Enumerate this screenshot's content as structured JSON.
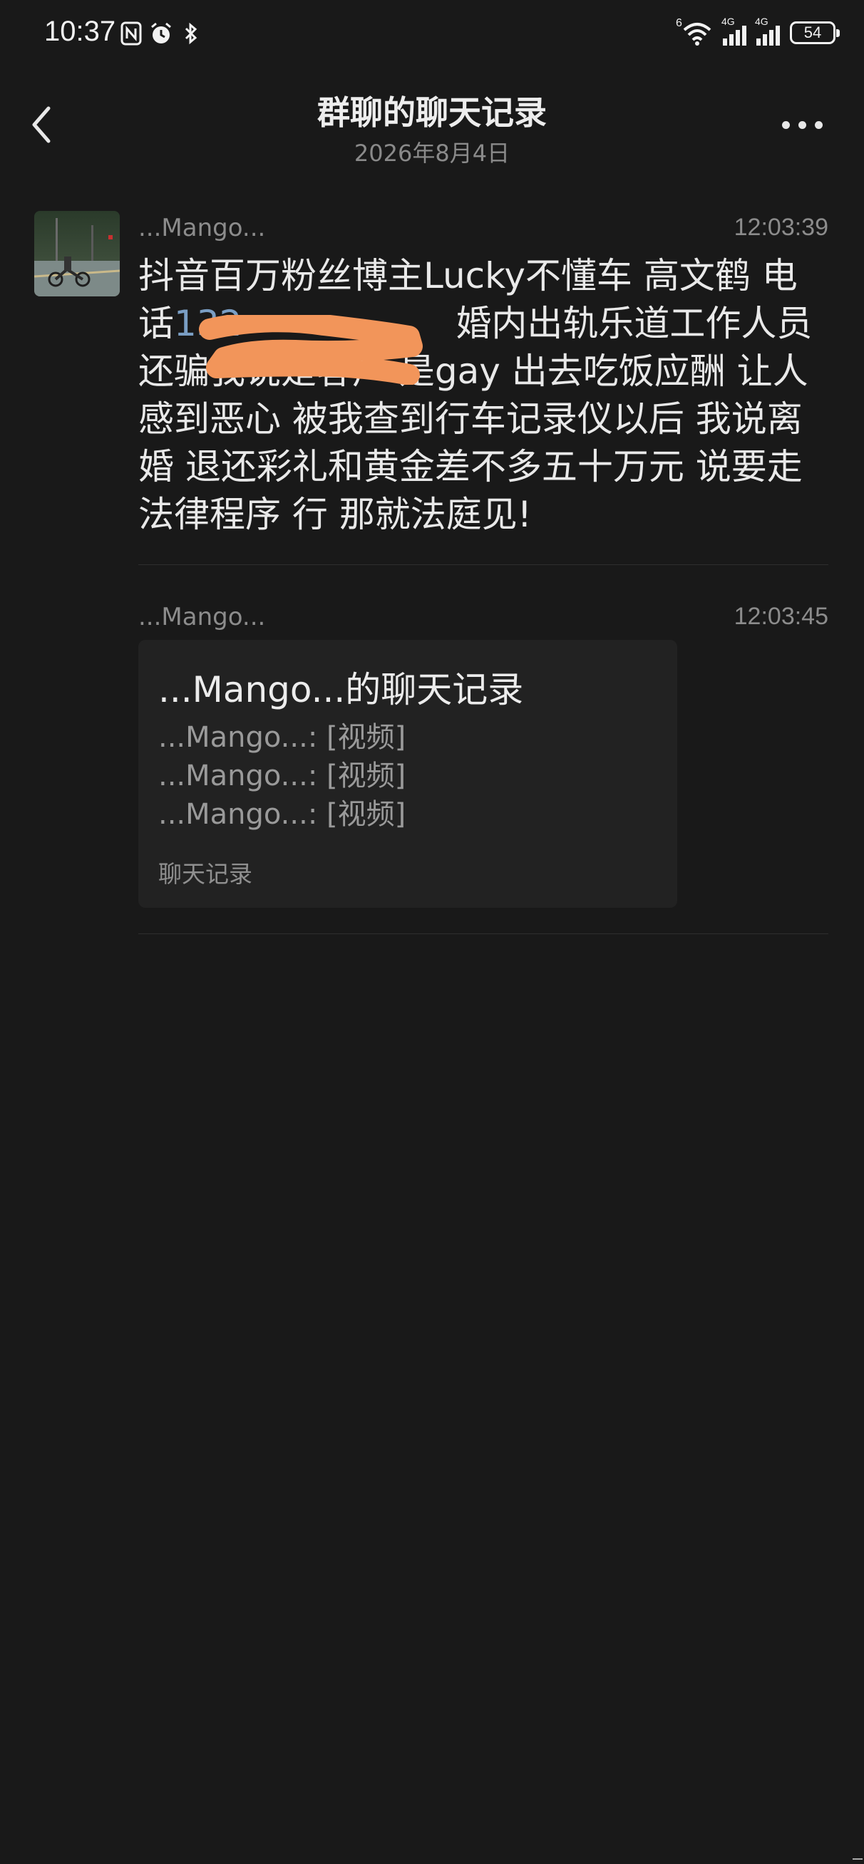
{
  "status_bar": {
    "time": "10:37",
    "icons_left": [
      "nfc-icon",
      "alarm-icon",
      "bluetooth-icon"
    ],
    "wifi_tag": "6",
    "sim1_tag": "4G",
    "sim2_tag": "4G",
    "battery_level": "54"
  },
  "header": {
    "title": "群聊的聊天记录",
    "date": "2026年8月4日",
    "back_icon": "chevron-left-icon",
    "more_icon": "more-dots-icon"
  },
  "messages": [
    {
      "sender": "...Mango...",
      "time": "12:03:39",
      "text_before_phone": "抖音百万粉丝博主Lucky不懂车 高文鹤 电话",
      "phone_visible": "132",
      "text_after_phone": "婚内出轨乐道工作人员还骗我说是客户 是gay 出去吃饭应酬 让人感到恶心 被我查到行车记录仪以后 我说离婚 退还彩礼和黄金差不多五十万元 说要走法律程序 行 那就法庭见!"
    },
    {
      "sender": "...Mango...",
      "time": "12:03:45",
      "card": {
        "title": "...Mango...的聊天记录",
        "lines": [
          "...Mango...: [视频]",
          "...Mango...: [视频]",
          "...Mango...: [视频]"
        ],
        "footer": "聊天记录"
      }
    }
  ],
  "colors": {
    "background": "#191919",
    "link": "#7a9ec4",
    "redaction": "#f2955a"
  }
}
